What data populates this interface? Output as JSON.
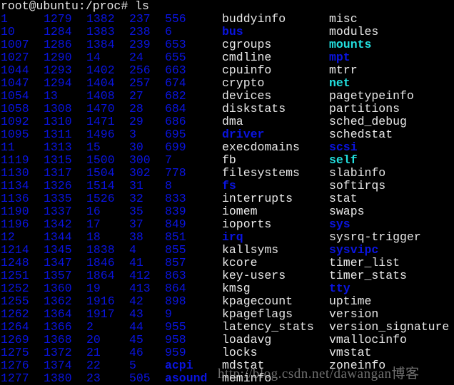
{
  "terminal": {
    "prompt": "root@ubuntu:/proc# ls",
    "colors": {
      "background": "#000000",
      "directory": "#0a14e0",
      "file": "#e8e8e8",
      "symlink": "#22e0e0"
    },
    "rows": [
      [
        [
          "1",
          "d"
        ],
        [
          "1279",
          "d"
        ],
        [
          "1382",
          "d"
        ],
        [
          "237",
          "d"
        ],
        [
          "556",
          "d"
        ],
        [
          "buddyinfo",
          "f"
        ],
        [
          "misc",
          "f"
        ]
      ],
      [
        [
          "10",
          "d"
        ],
        [
          "1284",
          "d"
        ],
        [
          "1383",
          "d"
        ],
        [
          "238",
          "d"
        ],
        [
          "6",
          "d"
        ],
        [
          "bus",
          "d"
        ],
        [
          "modules",
          "f"
        ]
      ],
      [
        [
          "1007",
          "d"
        ],
        [
          "1286",
          "d"
        ],
        [
          "1384",
          "d"
        ],
        [
          "239",
          "d"
        ],
        [
          "653",
          "d"
        ],
        [
          "cgroups",
          "f"
        ],
        [
          "mounts",
          "l"
        ]
      ],
      [
        [
          "1027",
          "d"
        ],
        [
          "1290",
          "d"
        ],
        [
          "14",
          "d"
        ],
        [
          "24",
          "d"
        ],
        [
          "655",
          "d"
        ],
        [
          "cmdline",
          "f"
        ],
        [
          "mpt",
          "d"
        ]
      ],
      [
        [
          "1044",
          "d"
        ],
        [
          "1293",
          "d"
        ],
        [
          "1402",
          "d"
        ],
        [
          "256",
          "d"
        ],
        [
          "663",
          "d"
        ],
        [
          "cpuinfo",
          "f"
        ],
        [
          "mtrr",
          "f"
        ]
      ],
      [
        [
          "1047",
          "d"
        ],
        [
          "1294",
          "d"
        ],
        [
          "1404",
          "d"
        ],
        [
          "257",
          "d"
        ],
        [
          "674",
          "d"
        ],
        [
          "crypto",
          "f"
        ],
        [
          "net",
          "l"
        ]
      ],
      [
        [
          "1054",
          "d"
        ],
        [
          "13",
          "d"
        ],
        [
          "1408",
          "d"
        ],
        [
          "27",
          "d"
        ],
        [
          "682",
          "d"
        ],
        [
          "devices",
          "f"
        ],
        [
          "pagetypeinfo",
          "f"
        ]
      ],
      [
        [
          "1058",
          "d"
        ],
        [
          "1308",
          "d"
        ],
        [
          "1470",
          "d"
        ],
        [
          "28",
          "d"
        ],
        [
          "684",
          "d"
        ],
        [
          "diskstats",
          "f"
        ],
        [
          "partitions",
          "f"
        ]
      ],
      [
        [
          "1092",
          "d"
        ],
        [
          "1310",
          "d"
        ],
        [
          "1471",
          "d"
        ],
        [
          "29",
          "d"
        ],
        [
          "686",
          "d"
        ],
        [
          "dma",
          "f"
        ],
        [
          "sched_debug",
          "f"
        ]
      ],
      [
        [
          "1095",
          "d"
        ],
        [
          "1311",
          "d"
        ],
        [
          "1496",
          "d"
        ],
        [
          "3",
          "d"
        ],
        [
          "695",
          "d"
        ],
        [
          "driver",
          "d"
        ],
        [
          "schedstat",
          "f"
        ]
      ],
      [
        [
          "11",
          "d"
        ],
        [
          "1313",
          "d"
        ],
        [
          "15",
          "d"
        ],
        [
          "30",
          "d"
        ],
        [
          "699",
          "d"
        ],
        [
          "execdomains",
          "f"
        ],
        [
          "scsi",
          "d"
        ]
      ],
      [
        [
          "1119",
          "d"
        ],
        [
          "1315",
          "d"
        ],
        [
          "1500",
          "d"
        ],
        [
          "300",
          "d"
        ],
        [
          "7",
          "d"
        ],
        [
          "fb",
          "f"
        ],
        [
          "self",
          "l"
        ]
      ],
      [
        [
          "1130",
          "d"
        ],
        [
          "1317",
          "d"
        ],
        [
          "1504",
          "d"
        ],
        [
          "302",
          "d"
        ],
        [
          "778",
          "d"
        ],
        [
          "filesystems",
          "f"
        ],
        [
          "slabinfo",
          "f"
        ]
      ],
      [
        [
          "1134",
          "d"
        ],
        [
          "1326",
          "d"
        ],
        [
          "1514",
          "d"
        ],
        [
          "31",
          "d"
        ],
        [
          "8",
          "d"
        ],
        [
          "fs",
          "d"
        ],
        [
          "softirqs",
          "f"
        ]
      ],
      [
        [
          "1136",
          "d"
        ],
        [
          "1335",
          "d"
        ],
        [
          "1526",
          "d"
        ],
        [
          "32",
          "d"
        ],
        [
          "833",
          "d"
        ],
        [
          "interrupts",
          "f"
        ],
        [
          "stat",
          "f"
        ]
      ],
      [
        [
          "1190",
          "d"
        ],
        [
          "1337",
          "d"
        ],
        [
          "16",
          "d"
        ],
        [
          "35",
          "d"
        ],
        [
          "839",
          "d"
        ],
        [
          "iomem",
          "f"
        ],
        [
          "swaps",
          "f"
        ]
      ],
      [
        [
          "1196",
          "d"
        ],
        [
          "1342",
          "d"
        ],
        [
          "17",
          "d"
        ],
        [
          "37",
          "d"
        ],
        [
          "849",
          "d"
        ],
        [
          "ioports",
          "f"
        ],
        [
          "sys",
          "d"
        ]
      ],
      [
        [
          "12",
          "d"
        ],
        [
          "1344",
          "d"
        ],
        [
          "18",
          "d"
        ],
        [
          "38",
          "d"
        ],
        [
          "851",
          "d"
        ],
        [
          "irq",
          "d"
        ],
        [
          "sysrq-trigger",
          "f"
        ]
      ],
      [
        [
          "1214",
          "d"
        ],
        [
          "1345",
          "d"
        ],
        [
          "1838",
          "d"
        ],
        [
          "4",
          "d"
        ],
        [
          "855",
          "d"
        ],
        [
          "kallsyms",
          "f"
        ],
        [
          "sysvipc",
          "d"
        ]
      ],
      [
        [
          "1248",
          "d"
        ],
        [
          "1347",
          "d"
        ],
        [
          "1846",
          "d"
        ],
        [
          "41",
          "d"
        ],
        [
          "857",
          "d"
        ],
        [
          "kcore",
          "f"
        ],
        [
          "timer_list",
          "f"
        ]
      ],
      [
        [
          "1251",
          "d"
        ],
        [
          "1357",
          "d"
        ],
        [
          "1864",
          "d"
        ],
        [
          "412",
          "d"
        ],
        [
          "863",
          "d"
        ],
        [
          "key-users",
          "f"
        ],
        [
          "timer_stats",
          "f"
        ]
      ],
      [
        [
          "1252",
          "d"
        ],
        [
          "1360",
          "d"
        ],
        [
          "19",
          "d"
        ],
        [
          "413",
          "d"
        ],
        [
          "864",
          "d"
        ],
        [
          "kmsg",
          "f"
        ],
        [
          "tty",
          "d"
        ]
      ],
      [
        [
          "1255",
          "d"
        ],
        [
          "1362",
          "d"
        ],
        [
          "1916",
          "d"
        ],
        [
          "42",
          "d"
        ],
        [
          "898",
          "d"
        ],
        [
          "kpagecount",
          "f"
        ],
        [
          "uptime",
          "f"
        ]
      ],
      [
        [
          "1262",
          "d"
        ],
        [
          "1364",
          "d"
        ],
        [
          "1917",
          "d"
        ],
        [
          "43",
          "d"
        ],
        [
          "9",
          "d"
        ],
        [
          "kpageflags",
          "f"
        ],
        [
          "version",
          "f"
        ]
      ],
      [
        [
          "1264",
          "d"
        ],
        [
          "1366",
          "d"
        ],
        [
          "2",
          "d"
        ],
        [
          "44",
          "d"
        ],
        [
          "955",
          "d"
        ],
        [
          "latency_stats",
          "f"
        ],
        [
          "version_signature",
          "f"
        ]
      ],
      [
        [
          "1269",
          "d"
        ],
        [
          "1368",
          "d"
        ],
        [
          "20",
          "d"
        ],
        [
          "45",
          "d"
        ],
        [
          "958",
          "d"
        ],
        [
          "loadavg",
          "f"
        ],
        [
          "vmallocinfo",
          "f"
        ]
      ],
      [
        [
          "1275",
          "d"
        ],
        [
          "1372",
          "d"
        ],
        [
          "21",
          "d"
        ],
        [
          "46",
          "d"
        ],
        [
          "959",
          "d"
        ],
        [
          "locks",
          "f"
        ],
        [
          "vmstat",
          "f"
        ]
      ],
      [
        [
          "1276",
          "d"
        ],
        [
          "1374",
          "d"
        ],
        [
          "22",
          "d"
        ],
        [
          "5",
          "d"
        ],
        [
          "acpi",
          "d"
        ],
        [
          "mdstat",
          "f"
        ],
        [
          "zoneinfo",
          "f"
        ]
      ],
      [
        [
          "1277",
          "d"
        ],
        [
          "1380",
          "d"
        ],
        [
          "23",
          "d"
        ],
        [
          "505",
          "d"
        ],
        [
          "asound",
          "d"
        ],
        [
          "meminfo",
          "f"
        ]
      ]
    ]
  },
  "watermark": "http://blog.csdn.net/dawangan博客"
}
